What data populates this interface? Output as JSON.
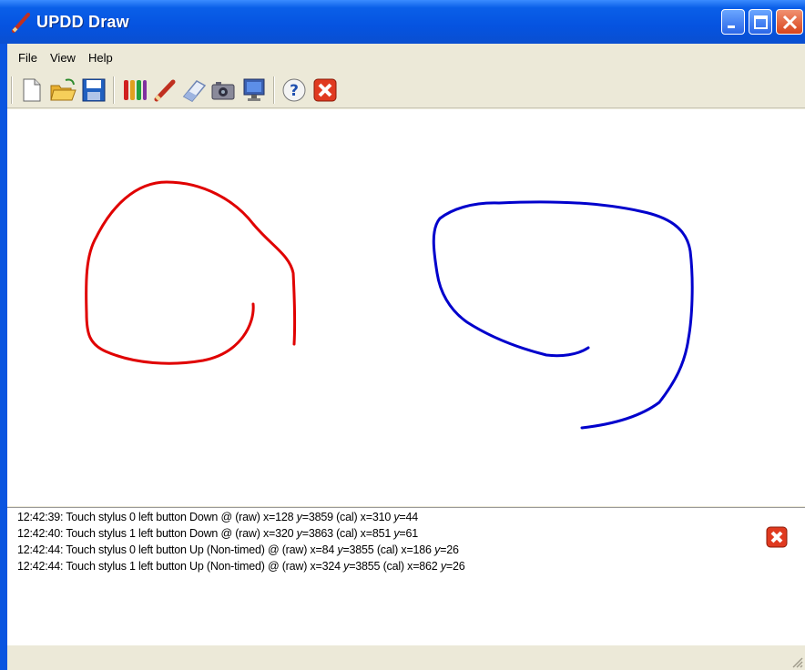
{
  "window": {
    "title": "UPDD Draw"
  },
  "menu": {
    "items": [
      "File",
      "View",
      "Help"
    ]
  },
  "toolbar": {
    "icons": [
      "new-icon",
      "open-icon",
      "save-icon",
      "colors-icon",
      "pencil-icon",
      "eraser-icon",
      "camera-icon",
      "monitor-icon",
      "help-icon",
      "close-icon"
    ]
  },
  "strokes": [
    {
      "name": "red-stroke",
      "color": "#e00000"
    },
    {
      "name": "blue-stroke",
      "color": "#0000cc"
    }
  ],
  "log": {
    "lines": [
      {
        "prefix": "12:42:39: Touch stylus 0 left button Down  @ (raw) x=128 ",
        "y1k": "y",
        "y1v": "=3859 (cal) x=310 ",
        "y2k": "y",
        "y2v": "=44"
      },
      {
        "prefix": "12:42:40: Touch stylus 1 left button Down  @ (raw) x=320 ",
        "y1k": "y",
        "y1v": "=3863 (cal) x=851 ",
        "y2k": "y",
        "y2v": "=61"
      },
      {
        "prefix": "12:42:44: Touch stylus 0 left button Up (Non-timed) @ (raw) x=84 ",
        "y1k": "y",
        "y1v": "=3855 (cal) x=186 ",
        "y2k": "y",
        "y2v": "=26"
      },
      {
        "prefix": "12:42:44: Touch stylus 1 left button Up (Non-timed) @ (raw) x=324 ",
        "y1k": "y",
        "y1v": "=3855 (cal) x=862 ",
        "y2k": "y",
        "y2v": "=26"
      }
    ]
  }
}
